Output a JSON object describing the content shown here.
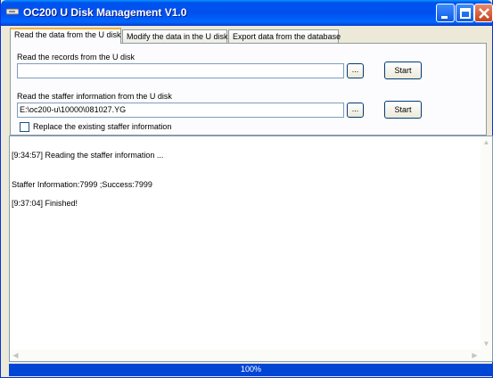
{
  "window": {
    "title": "OC200 U Disk Management V1.0"
  },
  "tabs": [
    {
      "label": "Read the data from the U disk"
    },
    {
      "label": "Modify the data in the U disk"
    },
    {
      "label": "Export data from the database"
    }
  ],
  "read_records": {
    "label": "Read the records from the U disk",
    "path_value": "",
    "browse_label": "...",
    "start_label": "Start"
  },
  "read_staffer": {
    "label": "Read the staffer information from the U disk",
    "path_value": "E:\\oc200-u\\10000\\081027.YG",
    "browse_label": "...",
    "start_label": "Start",
    "replace_checkbox_label": "Replace the existing staffer information",
    "replace_checked": false
  },
  "log": {
    "lines": [
      "[9:34:57] Reading the staffer information ...",
      "Staffer Information:7999 ;Success:7999",
      "[9:37:04] Finished!"
    ]
  },
  "status": {
    "progress_text": "100%",
    "progress_fraction": 1.0
  },
  "colors": {
    "titlebar": "#0055ea",
    "progress": "#0046d5",
    "tab_highlight": "#f2b33b"
  },
  "icons": [
    "app-icon",
    "minimize-icon",
    "maximize-icon",
    "close-icon"
  ]
}
